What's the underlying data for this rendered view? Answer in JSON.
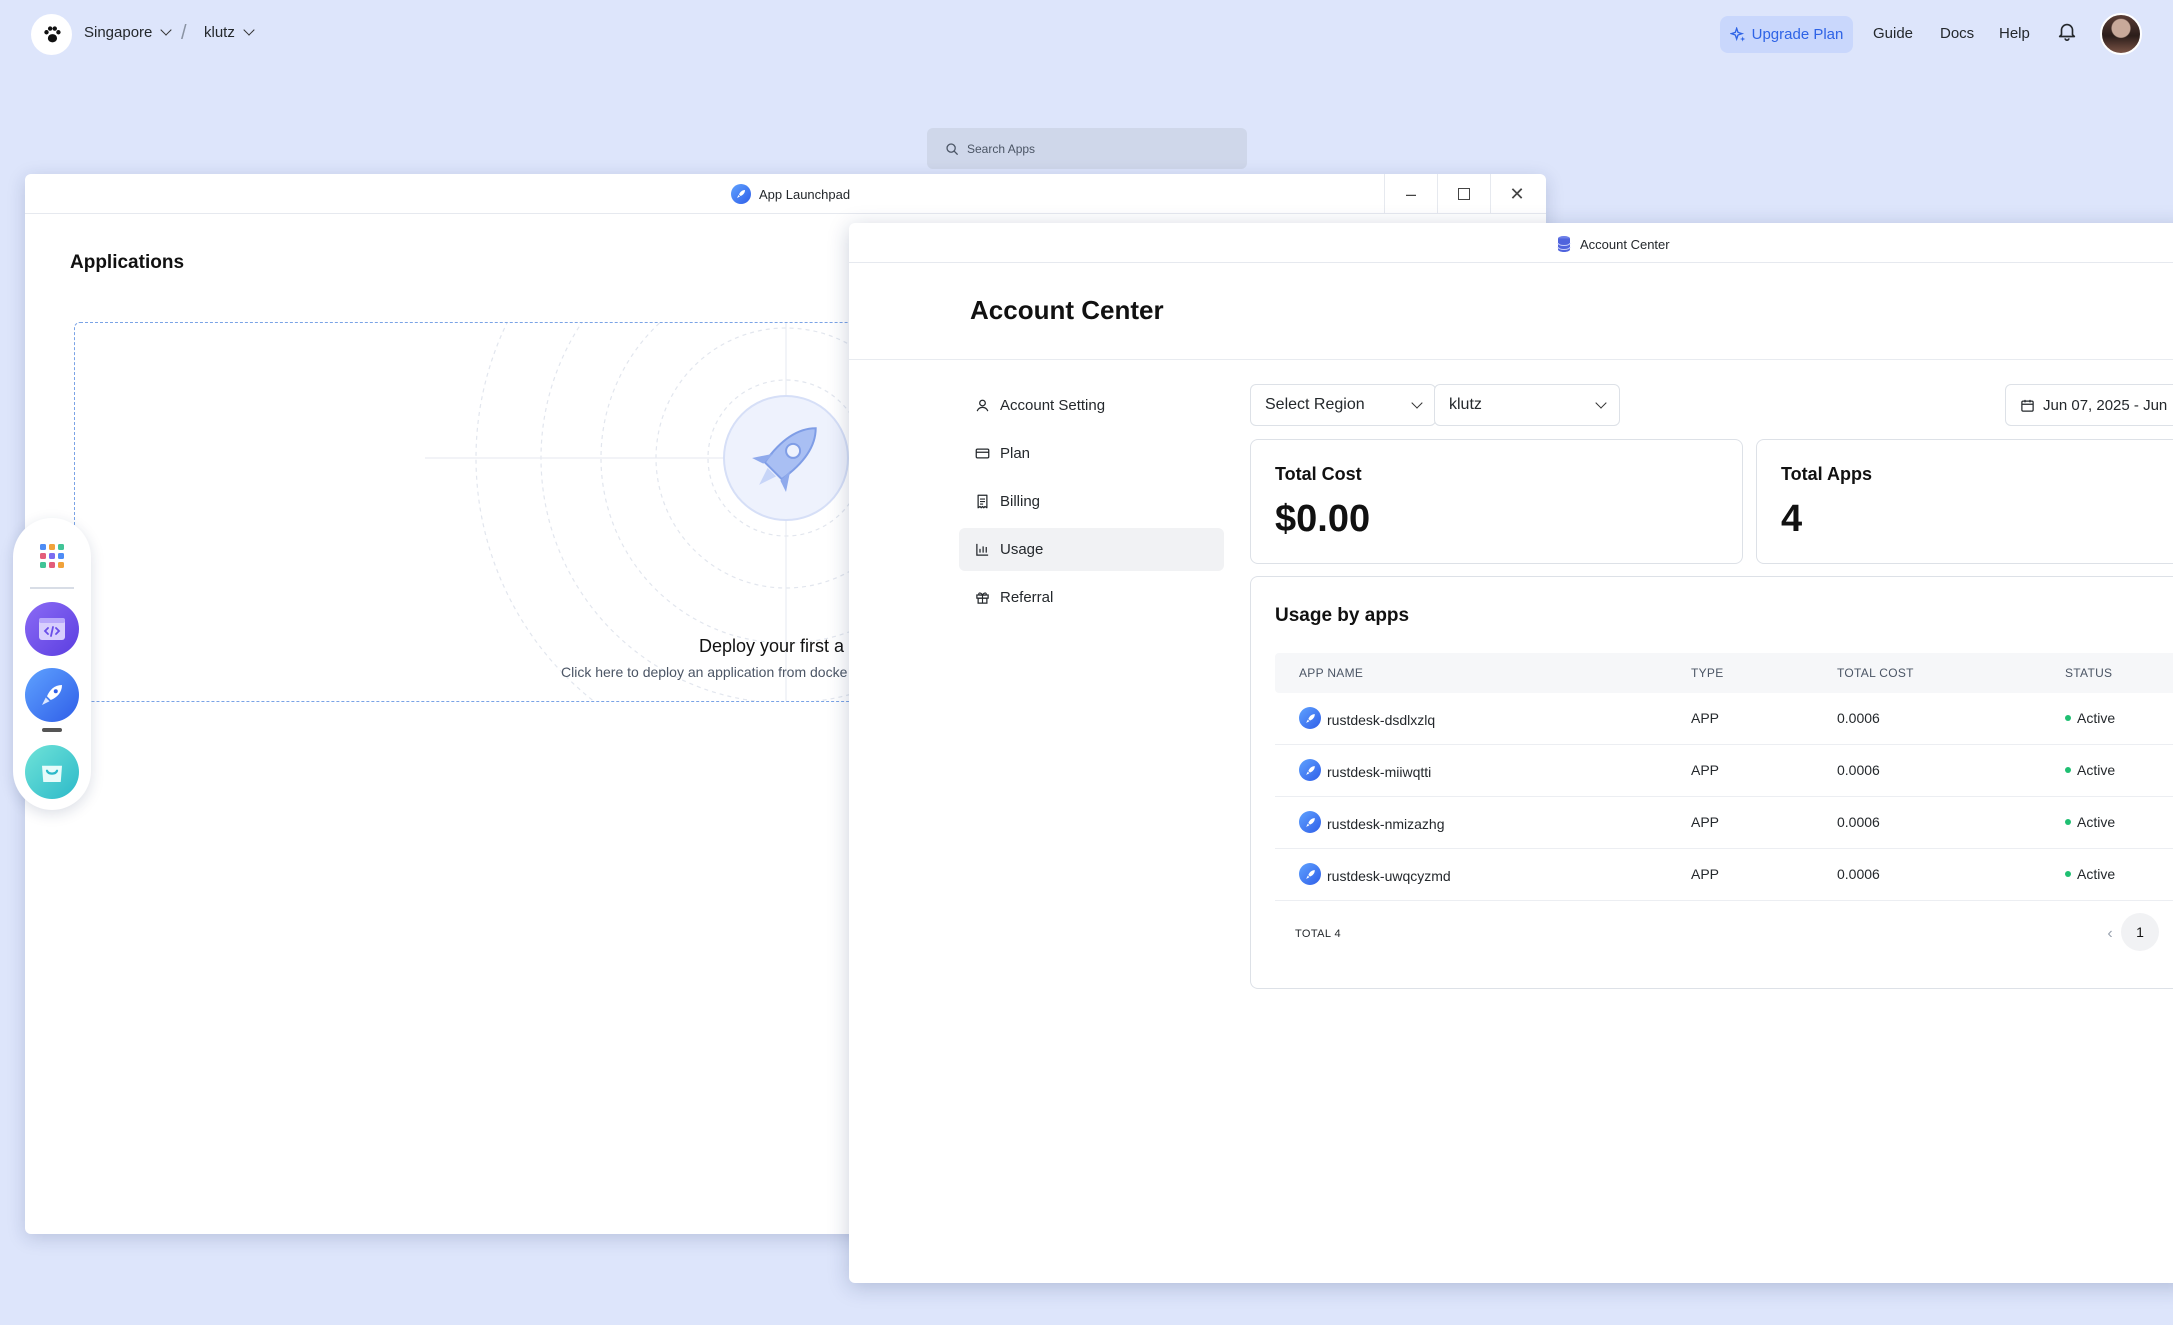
{
  "topbar": {
    "region": "Singapore",
    "workspace": "klutz",
    "upgrade_label": "Upgrade Plan",
    "links": [
      "Guide",
      "Docs",
      "Help"
    ]
  },
  "search": {
    "placeholder": "Search Apps"
  },
  "launchpad": {
    "window_title": "App Launchpad",
    "heading": "Applications",
    "deploy_title": "Deploy your first a",
    "deploy_subtitle": "Click here to deploy an application from docke"
  },
  "account_center": {
    "window_title": "Account Center",
    "heading": "Account Center",
    "sidebar": [
      {
        "label": "Account Setting",
        "icon": "user-icon"
      },
      {
        "label": "Plan",
        "icon": "card-icon"
      },
      {
        "label": "Billing",
        "icon": "receipt-icon"
      },
      {
        "label": "Usage",
        "icon": "bar-chart-icon",
        "active": true
      },
      {
        "label": "Referral",
        "icon": "gift-icon"
      }
    ],
    "filters": {
      "region_placeholder": "Select Region",
      "workspace_value": "klutz",
      "date_range": "Jun 07, 2025 - Jun"
    },
    "stats": {
      "total_cost_label": "Total Cost",
      "total_cost_value": "$0.00",
      "total_apps_label": "Total Apps",
      "total_apps_value": "4"
    },
    "usage": {
      "title": "Usage by apps",
      "columns": [
        "APP NAME",
        "TYPE",
        "TOTAL COST",
        "STATUS"
      ],
      "rows": [
        {
          "name": "rustdesk-dsdlxzlq",
          "type": "APP",
          "cost": "0.0006",
          "status": "Active"
        },
        {
          "name": "rustdesk-miiwqtti",
          "type": "APP",
          "cost": "0.0006",
          "status": "Active"
        },
        {
          "name": "rustdesk-nmizazhg",
          "type": "APP",
          "cost": "0.0006",
          "status": "Active"
        },
        {
          "name": "rustdesk-uwqcyzmd",
          "type": "APP",
          "cost": "0.0006",
          "status": "Active"
        }
      ],
      "total_label": "TOTAL 4",
      "current_page": "1"
    }
  },
  "colors": {
    "background": "#dde5fb",
    "accent": "#2e63e6",
    "active_status": "#1fbf72"
  }
}
